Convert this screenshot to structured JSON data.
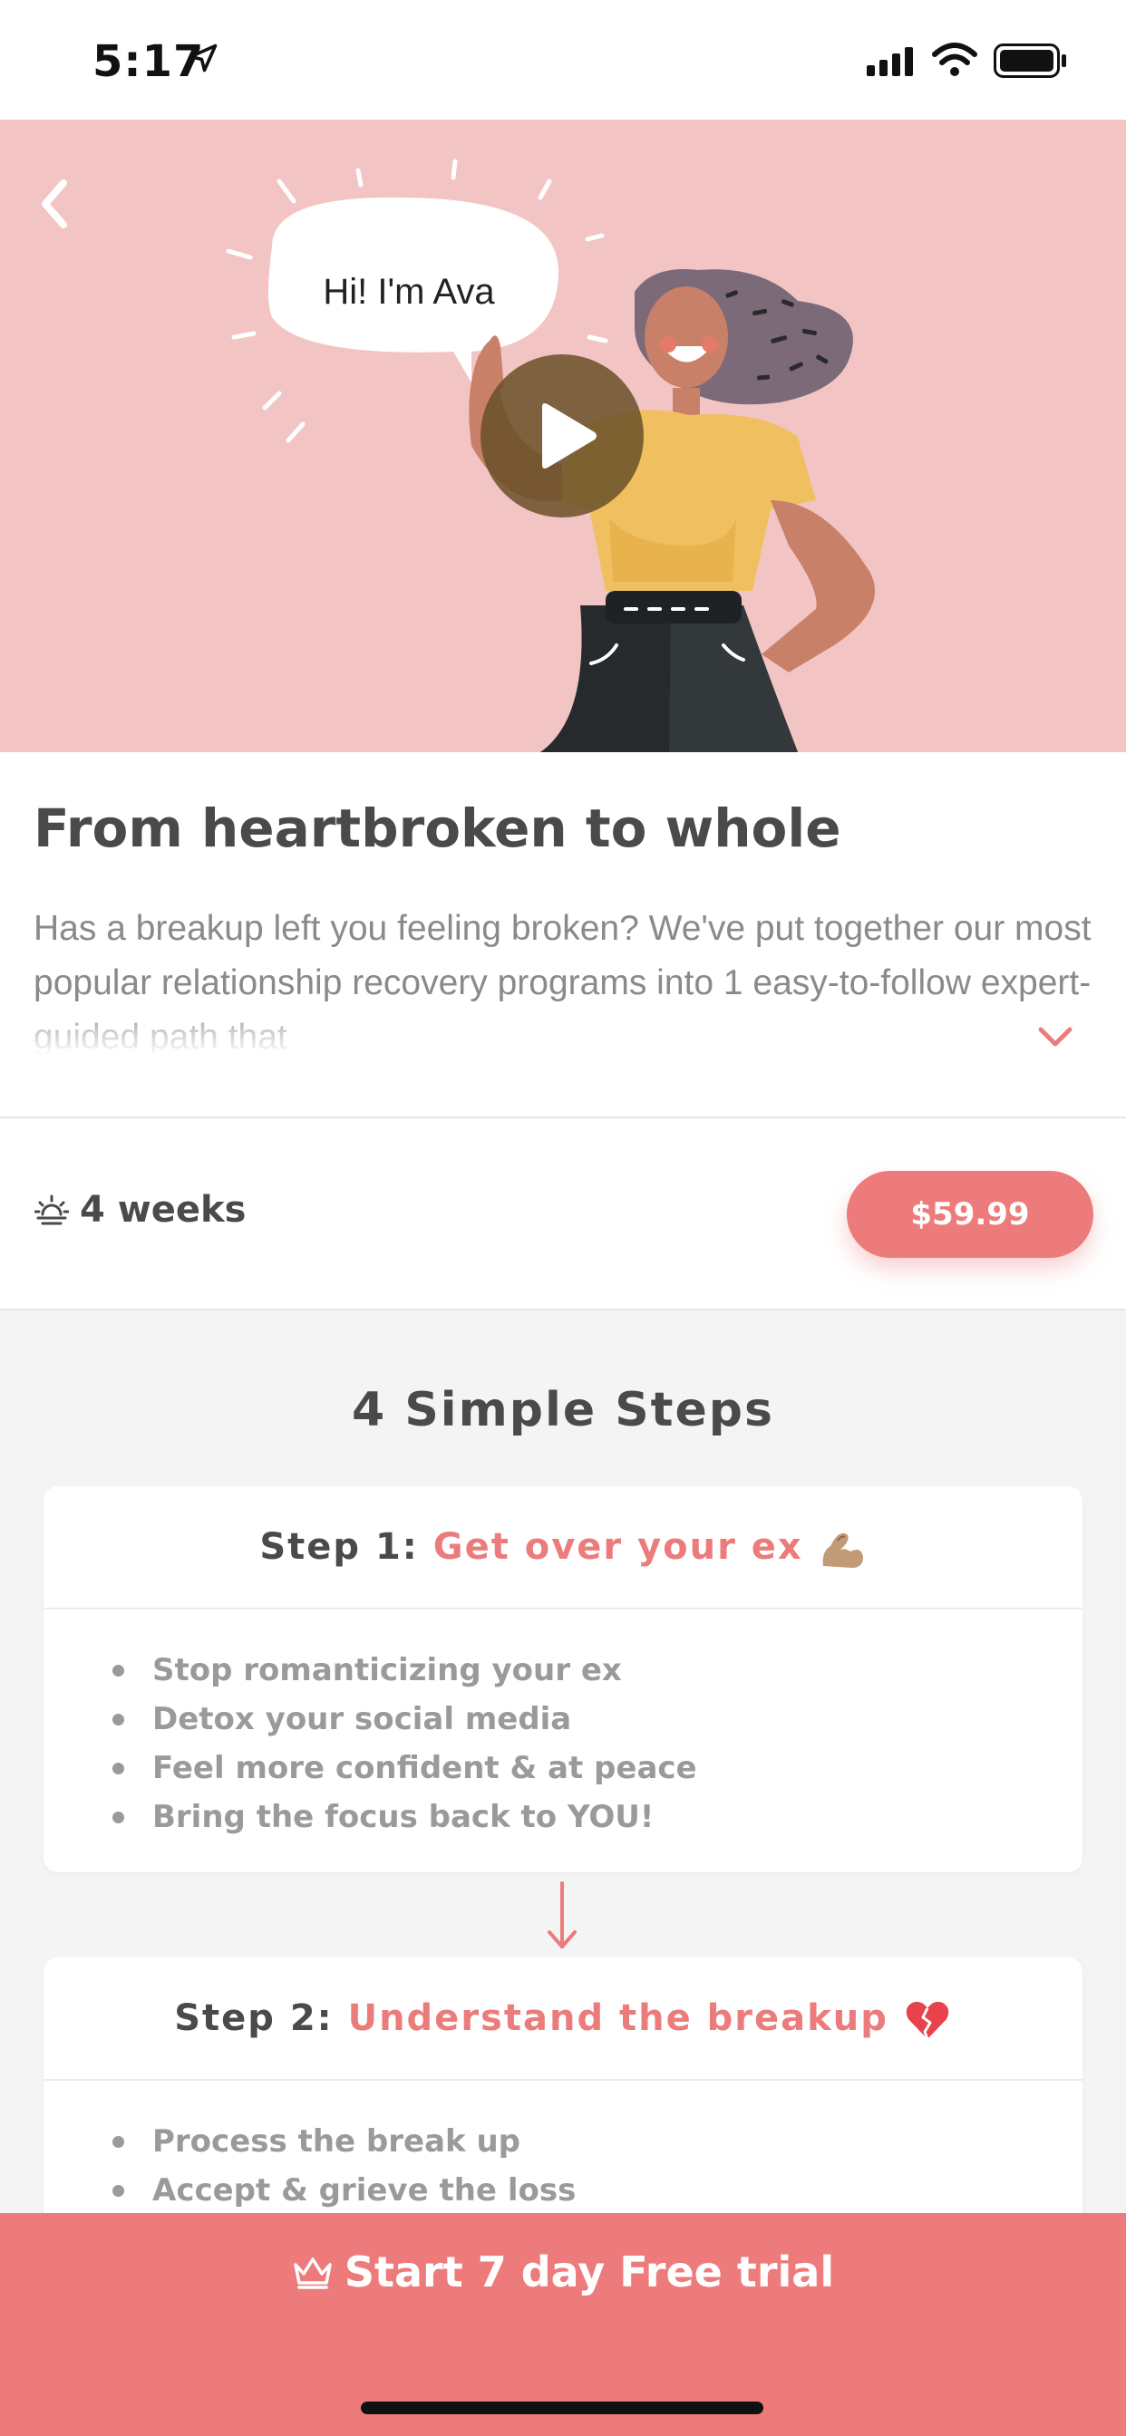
{
  "status_bar": {
    "time": "5:17",
    "icons": [
      "location-arrow-icon",
      "cellular-signal-icon",
      "wifi-icon",
      "battery-icon"
    ]
  },
  "hero": {
    "back_icon": "chevron-left-icon",
    "speech_bubble": "Hi! I'm Ava",
    "play_icon": "play-icon",
    "background_color": "#f3c4c4"
  },
  "program": {
    "title": "From heartbroken to whole",
    "description": "Has a breakup left you feeling broken? We've put together our most popular relationship recovery programs into 1 easy-to-follow expert-guided path that",
    "expand_icon": "chevron-down-icon",
    "duration": "4 weeks",
    "duration_icon": "sunrise-icon",
    "price": "$59.99"
  },
  "steps": {
    "heading": "4 Simple Steps",
    "items": [
      {
        "label": "Step 1:",
        "title": "Get over your ex",
        "emoji": "flexed-biceps-icon",
        "bullets": [
          "Stop romanticizing your ex",
          "Detox your social media",
          "Feel more confident & at peace",
          "Bring the focus back to YOU!"
        ]
      },
      {
        "label": "Step 2:",
        "title": "Understand the breakup",
        "emoji": "broken-heart-icon",
        "bullets": [
          "Process the break up",
          "Accept & grieve the loss"
        ]
      }
    ],
    "connector_icon": "arrow-down-icon"
  },
  "cta": {
    "label": "Start 7 day Free trial",
    "icon": "crown-icon",
    "color": "#ed7b7b"
  },
  "colors": {
    "accent": "#ed7b7b",
    "text_dark": "#4a4a4a",
    "text_muted": "#9a9a9a"
  }
}
